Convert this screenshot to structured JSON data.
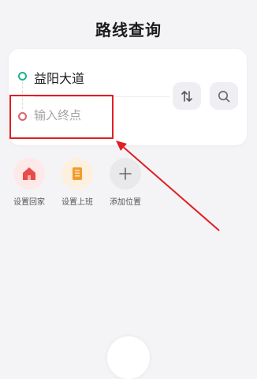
{
  "header": {
    "title": "路线查询"
  },
  "route": {
    "start_text": "益阳大道",
    "end_placeholder": "输入终点",
    "end_value": ""
  },
  "shortcuts": [
    {
      "label": "设置回家",
      "icon": "home-icon",
      "color": "#e94a4a",
      "bg": "#fde9e7"
    },
    {
      "label": "设置上班",
      "icon": "office-building-icon",
      "color": "#f39a2b",
      "bg": "#fdf0df"
    },
    {
      "label": "添加位置",
      "icon": "plus-icon",
      "color": "#6a6a6a",
      "bg": "#e9e9ec"
    }
  ],
  "colors": {
    "start_dot": "#20b38a",
    "end_dot": "#d9646b",
    "annotation": "#e01e24"
  }
}
